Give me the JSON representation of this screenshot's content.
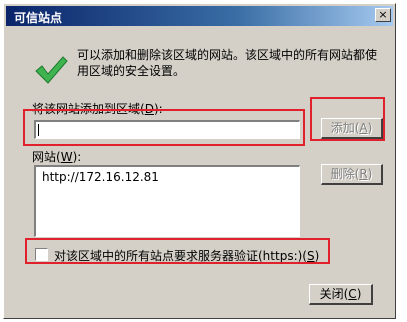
{
  "window": {
    "title": "可信站点",
    "close_glyph": "×"
  },
  "description": "可以添加和删除该区域的网站。该区域中的所有网站都使用区域的安全设置。",
  "add_section": {
    "label_pre": "将该网站添加到区域(",
    "label_key": "D",
    "label_post": "):",
    "input_value": "",
    "add_button_pre": "添加(",
    "add_button_key": "A",
    "add_button_post": ")"
  },
  "sites_section": {
    "label_pre": "网站(",
    "label_key": "W",
    "label_post": "):",
    "sites": [
      "http://172.16.12.81"
    ],
    "remove_button_pre": "删除(",
    "remove_button_key": "R",
    "remove_button_post": ")"
  },
  "require_https": {
    "label_pre": "对该区域中的所有站点要求服务器验证(https:)(",
    "label_key": "S",
    "label_post": ")",
    "checked": false
  },
  "close_button": {
    "pre": "关闭(",
    "key": "C",
    "post": ")"
  },
  "colors": {
    "titlebar_start": "#0a246a",
    "titlebar_end": "#a6caf0",
    "highlight": "#e0212b",
    "check_green": "#3fb34f"
  },
  "icons": {
    "check": "green-checkmark-icon"
  }
}
